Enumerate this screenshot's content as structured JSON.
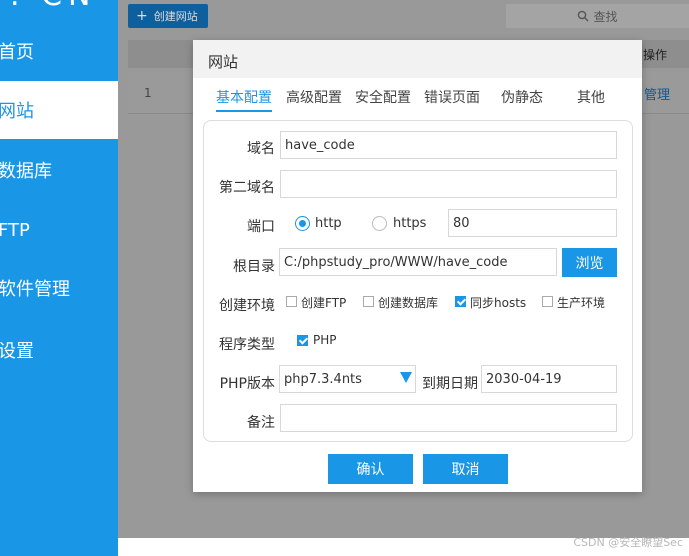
{
  "sidebar": {
    "logo": ". CN",
    "items": [
      {
        "label": "首页"
      },
      {
        "label": "网站"
      },
      {
        "label": "数据库"
      },
      {
        "label": "FTP"
      },
      {
        "label": "软件管理"
      },
      {
        "label": "设置"
      }
    ]
  },
  "toolbar": {
    "create_label": "创建网站",
    "search_label": "查找"
  },
  "table": {
    "ops_header": "操作",
    "rows": [
      {
        "num": "1",
        "action": "管理"
      }
    ]
  },
  "modal": {
    "title": "网站",
    "tabs": [
      {
        "label": "基本配置"
      },
      {
        "label": "高级配置"
      },
      {
        "label": "安全配置"
      },
      {
        "label": "错误页面"
      },
      {
        "label": "伪静态"
      },
      {
        "label": "其他"
      }
    ],
    "form": {
      "domain_label": "域名",
      "domain_value": "have_code",
      "second_domain_label": "第二域名",
      "second_domain_value": "",
      "port_label": "端口",
      "http_label": "http",
      "https_label": "https",
      "port_value": "80",
      "root_label": "根目录",
      "root_value": "C:/phpstudy_pro/WWW/have_code",
      "browse_label": "浏览",
      "env_label": "创建环境",
      "env_options": [
        {
          "label": "创建FTP",
          "checked": false
        },
        {
          "label": "创建数据库",
          "checked": false
        },
        {
          "label": "同步hosts",
          "checked": true
        },
        {
          "label": "生产环境",
          "checked": false
        }
      ],
      "program_label": "程序类型",
      "program_option": "PHP",
      "php_label": "PHP版本",
      "php_value": "php7.3.4nts",
      "expiry_label": "到期日期",
      "expiry_value": "2030-04-19",
      "note_label": "备注",
      "note_value": ""
    },
    "confirm_label": "确认",
    "cancel_label": "取消"
  },
  "watermark": "CSDN @安全瞭望Sec",
  "colors": {
    "accent": "#1a96e6"
  }
}
